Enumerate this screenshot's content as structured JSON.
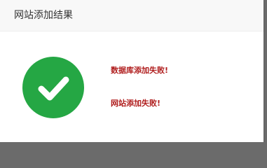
{
  "dialog": {
    "title": "网站添加结果",
    "status_icon": "check-circle-icon",
    "status_color": "#25a744",
    "message_color": "#b01e1e",
    "messages": [
      "数据库添加失败!",
      "网站添加失败!"
    ]
  }
}
